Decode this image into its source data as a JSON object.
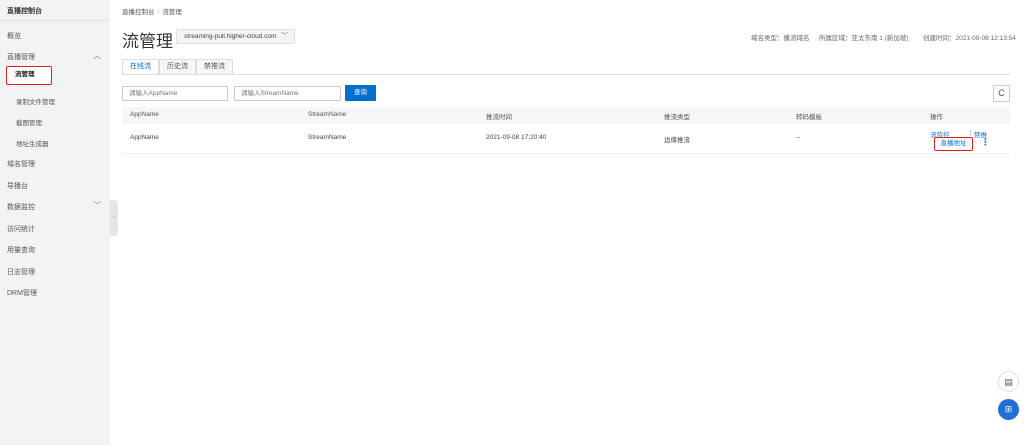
{
  "sidebar": {
    "title": "直播控制台",
    "items": [
      {
        "label": "概览"
      },
      {
        "label": "直播管理"
      },
      {
        "label": "流管理"
      },
      {
        "label": "录制文件管理"
      },
      {
        "label": "截图管理"
      },
      {
        "label": "地址生成器"
      },
      {
        "label": "域名管理"
      },
      {
        "label": "导播台"
      },
      {
        "label": "数据监控"
      },
      {
        "label": "访问统计"
      },
      {
        "label": "用量查询"
      },
      {
        "label": "日志管理"
      },
      {
        "label": "DRM管理"
      }
    ]
  },
  "breadcrumb": {
    "root": "直播控制台",
    "sep": "/",
    "current": "流管理"
  },
  "header": {
    "title": "流管理",
    "domain": "streaming-pull.higher-cloud.com",
    "domain_type": "域名类型：播流域名",
    "region": "所属区域：亚太东南 1 (新加坡)",
    "created": "创建时间：2021-09-08 12:13:54"
  },
  "tabs": [
    {
      "label": "在线流"
    },
    {
      "label": "历史流"
    },
    {
      "label": "禁推流"
    }
  ],
  "filters": {
    "app_placeholder": "请输入AppName",
    "stream_placeholder": "请输入StreamName",
    "query_label": "查询"
  },
  "table": {
    "columns": [
      "AppName",
      "StreamName",
      "推流时间",
      "推流类型",
      "转码模板",
      "操作"
    ],
    "rows": [
      {
        "app": "AppName",
        "stream": "StreamName",
        "time": "2021-09-08 17:20:40",
        "type": "边缘推流",
        "template": "--"
      }
    ],
    "actions": {
      "monitor": "流监控",
      "ban": "禁推",
      "url": "直播地址",
      "more": "⋮"
    }
  },
  "icons": {
    "chevron_up": "︿",
    "chevron_down": "﹀",
    "refresh": "C",
    "collapse": "‹"
  },
  "colors": {
    "accent": "#0070cc",
    "highlight": "#e02020"
  }
}
